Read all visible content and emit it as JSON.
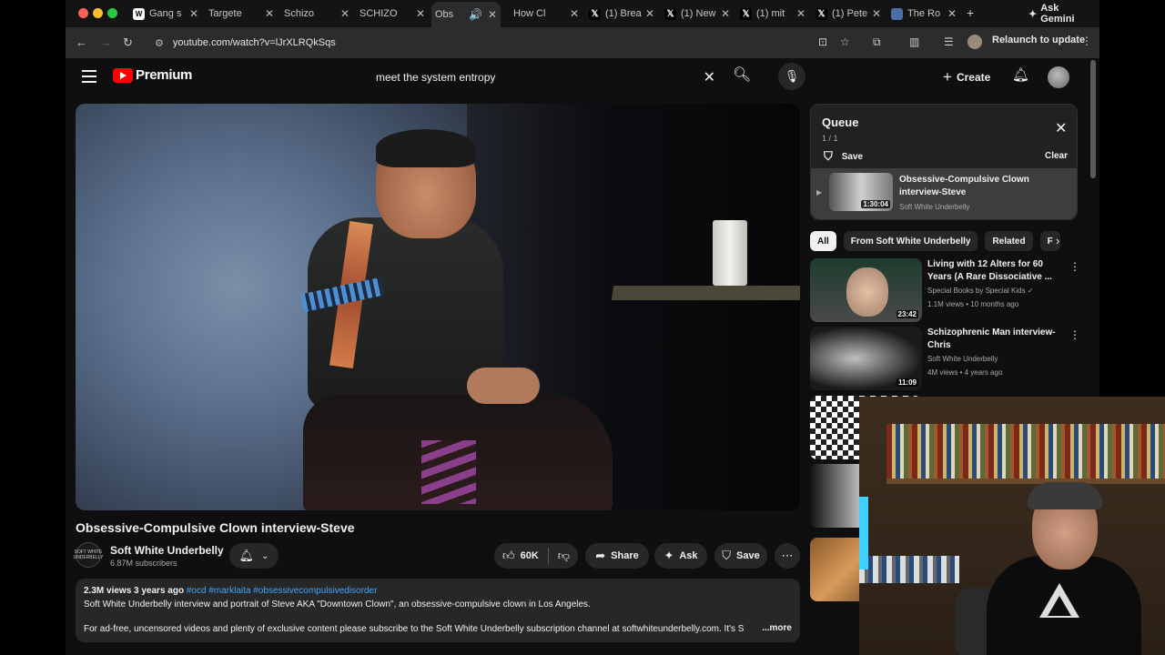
{
  "browser": {
    "tabs": [
      {
        "label": "Gang s",
        "favicon": "w"
      },
      {
        "label": "Targete",
        "favicon": "yt"
      },
      {
        "label": "Schizo",
        "favicon": "yt"
      },
      {
        "label": "SCHIZO",
        "favicon": "yt"
      },
      {
        "label": "Obs",
        "favicon": "yt",
        "active": true
      },
      {
        "label": "How Cl",
        "favicon": "yt"
      },
      {
        "label": "(1) Brea",
        "favicon": "x"
      },
      {
        "label": "(1) New",
        "favicon": "x"
      },
      {
        "label": "(1) mit",
        "favicon": "x"
      },
      {
        "label": "(1) Pete",
        "favicon": "x"
      },
      {
        "label": "The Ro",
        "favicon": "doc"
      }
    ],
    "ask_gemini": "Ask Gemini",
    "url": "youtube.com/watch?v=lJrXLRQkSqs",
    "relaunch": "Relaunch to update"
  },
  "youtube": {
    "logo_text": "Premium",
    "search_query": "meet the system entropy",
    "create_label": "Create"
  },
  "video": {
    "title": "Obsessive-Compulsive Clown interview-Steve",
    "channel": "Soft White Underbelly",
    "channel_avatar_text": "SOFT WHITE UNDERBELLY",
    "subscribers": "6.87M subscribers",
    "likes": "60K",
    "share": "Share",
    "ask": "Ask",
    "save": "Save",
    "views_date": "2.3M views  3 years ago",
    "tags": "#ocd #marklaita #obsessivecompulsivedisorder",
    "desc_line1": "Soft White Underbelly interview and portrait of Steve AKA \"Downtown Clown\", an obsessive-compulsive clown in Los Angeles.",
    "desc_line2": "For ad-free, uncensored videos and plenty of exclusive content please subscribe to the Soft White Underbelly subscription channel at softwhiteunderbelly.com. It's S",
    "more": "...more"
  },
  "queue": {
    "title": "Queue",
    "count": "1 / 1",
    "save": "Save",
    "clear": "Clear",
    "item": {
      "title": "Obsessive-Compulsive Clown interview-Steve",
      "channel": "Soft White Underbelly",
      "duration": "1:30:04"
    }
  },
  "chips": [
    "All",
    "From Soft White Underbelly",
    "Related",
    "F"
  ],
  "related": [
    {
      "title": "Living with 12 Alters for 60 Years (A Rare Dissociative ...",
      "channel": "Special Books by Special Kids ✓",
      "meta": "1.1M views • 10 months ago",
      "duration": "23:42"
    },
    {
      "title": "Schizophrenic Man interview-Chris",
      "channel": "Soft White Underbelly",
      "meta": "4M views • 4 years ago",
      "duration": "11:09"
    }
  ]
}
